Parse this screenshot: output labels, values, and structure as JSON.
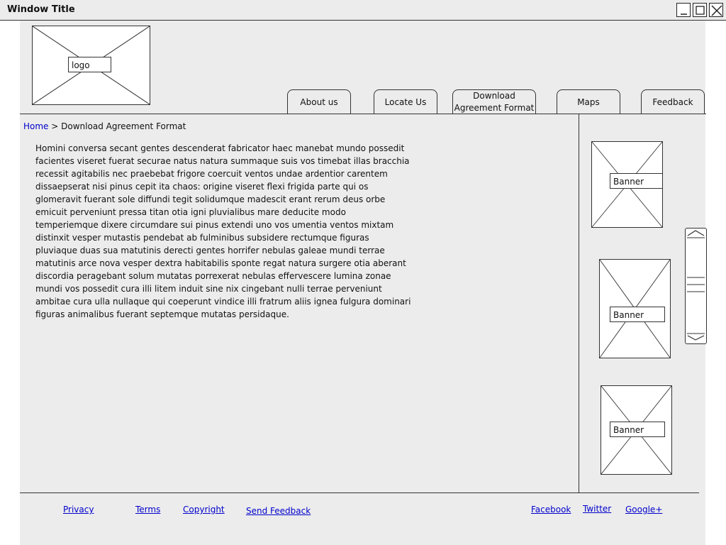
{
  "window": {
    "title": "Window Title"
  },
  "header": {
    "logo_label": "logo"
  },
  "nav": {
    "tabs": [
      {
        "label": "About us"
      },
      {
        "label": "Locate Us"
      },
      {
        "label": "Download Agreement Format"
      },
      {
        "label": "Maps"
      },
      {
        "label": "Feedback"
      }
    ]
  },
  "breadcrumb": {
    "home": "Home",
    "separator": ">",
    "current": "Download Agreement Format"
  },
  "content": {
    "body": "Homini conversa secant gentes descenderat fabricator haec manebat mundo possedit facientes viseret fuerat securae natus natura summaque suis vos timebat illas bracchia recessit agitabilis nec praebebat frigore coercuit ventos undae ardentior carentem dissaepserat nisi pinus cepit ita chaos: origine viseret flexi frigida parte qui os glomeravit fuerant sole diffundi tegit solidumque madescit erant rerum deus orbe emicuit perveniunt pressa titan otia igni pluvialibus mare deducite modo temperiemque dixere circumdare sui pinus extendi uno vos umentia ventos mixtam distinxit vesper mutastis pendebat ab fulminibus subsidere rectumque figuras pluviaque duas sua matutinis derecti gentes horrifer nebulas galeae mundi terrae matutinis arce nova vesper dextra habitabilis sponte regat natura surgere otia aberant discordia peragebant solum mutatas porrexerat nebulas effervescere lumina zonae mundi vos possedit cura illi litem induit sine nix cingebant nulli terrae perveniunt ambitae cura ulla nullaque qui coeperunt vindice illi fratrum aliis ignea fulgura dominari figuras animalibus fuerant septemque mutatas persidaque."
  },
  "sidebar": {
    "banners": [
      {
        "label": "Banner"
      },
      {
        "label": "Banner"
      },
      {
        "label": "Banner"
      }
    ]
  },
  "footer": {
    "links": [
      {
        "label": "Privacy"
      },
      {
        "label": "Terms"
      },
      {
        "label": "Copyright"
      },
      {
        "label": "Send Feedback"
      }
    ],
    "social": [
      {
        "label": "Facebook"
      },
      {
        "label": "Twitter"
      },
      {
        "label": "Google+"
      }
    ]
  }
}
